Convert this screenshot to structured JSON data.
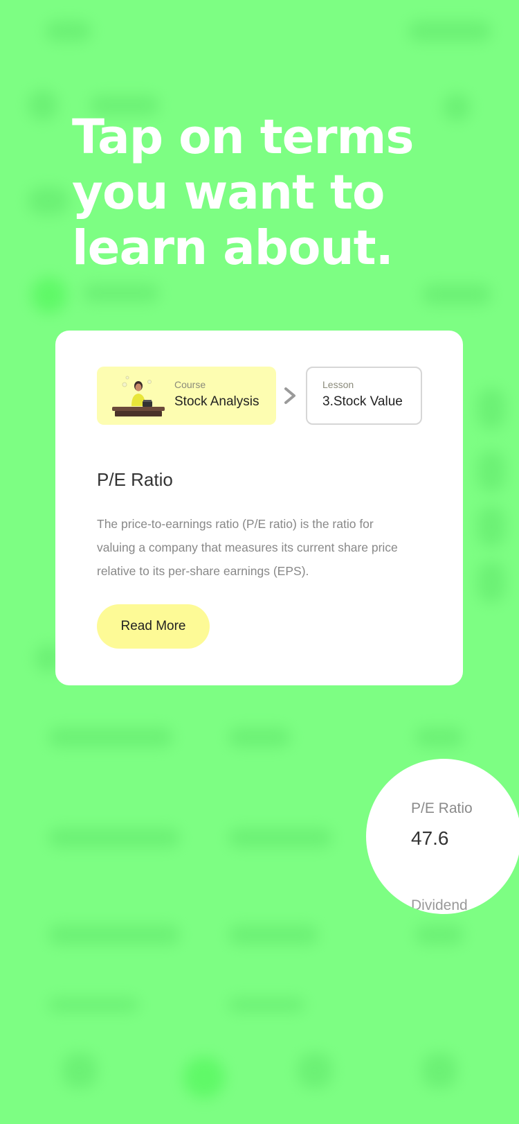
{
  "overlay": {
    "headline": "Tap on terms you want to learn about."
  },
  "breadcrumb": {
    "course_label": "Course",
    "course_value": "Stock Analysis",
    "separator_icon": "chevron-right-icon",
    "lesson_label": "Lesson",
    "lesson_value": "3.Stock Value"
  },
  "term_card": {
    "title": "P/E Ratio",
    "description": "The price-to-earnings ratio (P/E ratio) is the ratio for valuing a company that measures its current share price relative to its per-share earnings (EPS).",
    "read_more_label": "Read More"
  },
  "magnifier": {
    "term": "P/E Ratio",
    "value": "47.6",
    "next_term": "Dividend"
  },
  "colors": {
    "background": "#7dfe83",
    "course_chip": "#fdfdb1",
    "read_more_button": "#fdfa96",
    "card": "#ffffff"
  }
}
